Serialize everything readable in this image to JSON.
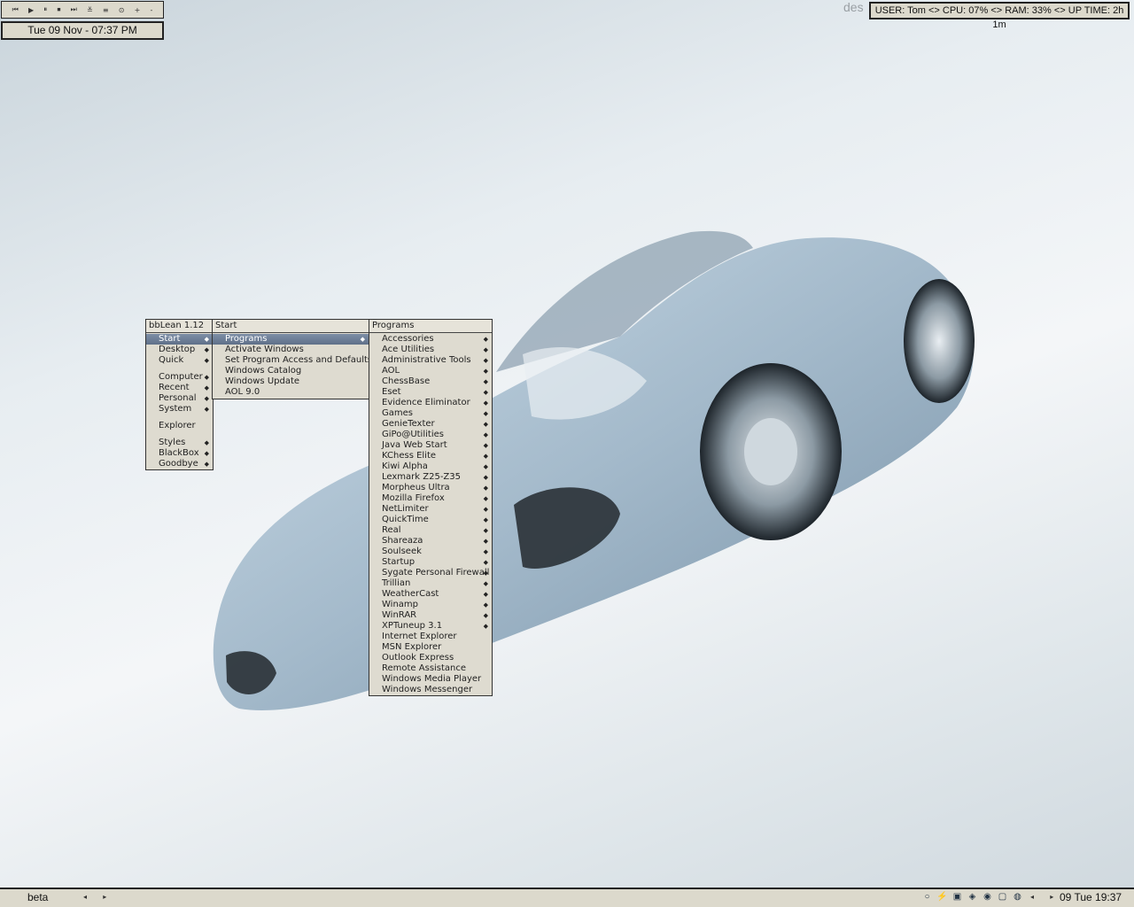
{
  "desktop": {
    "corner_text": "des"
  },
  "media_bar": {
    "buttons": [
      "⏮",
      "▶",
      "⏸",
      "⏹",
      "⏭",
      "≚",
      "≡",
      "⊙",
      "+",
      "-"
    ]
  },
  "clock": {
    "text": "Tue 09 Nov - 07:37 PM"
  },
  "sysmon": {
    "text": "USER: Tom <> CPU: 07% <> RAM: 33% <> UP TIME: 2h 1m"
  },
  "menus": {
    "root": {
      "title": "bbLean 1.12",
      "items": [
        {
          "label": "Start",
          "submenu": true
        },
        {
          "label": "Desktop",
          "submenu": true
        },
        {
          "label": "Quick",
          "submenu": true
        },
        {
          "label": "Computer",
          "submenu": true
        },
        {
          "label": "Recent",
          "submenu": true
        },
        {
          "label": "Personal",
          "submenu": true
        },
        {
          "label": "System",
          "submenu": true
        },
        {
          "label": "Explorer",
          "submenu": false
        },
        {
          "label": "Styles",
          "submenu": true
        },
        {
          "label": "BlackBox",
          "submenu": true
        },
        {
          "label": "Goodbye",
          "submenu": true
        }
      ]
    },
    "start": {
      "title": "Start",
      "items": [
        {
          "label": "Programs",
          "submenu": true
        },
        {
          "label": "Activate Windows",
          "submenu": false
        },
        {
          "label": "Set Program Access and Defaults",
          "submenu": false
        },
        {
          "label": "Windows Catalog",
          "submenu": false
        },
        {
          "label": "Windows Update",
          "submenu": false
        },
        {
          "label": "AOL 9.0",
          "submenu": false
        }
      ]
    },
    "programs": {
      "title": "Programs",
      "items": [
        {
          "label": "Accessories",
          "submenu": true
        },
        {
          "label": "Ace Utilities",
          "submenu": true
        },
        {
          "label": "Administrative Tools",
          "submenu": true
        },
        {
          "label": "AOL",
          "submenu": true
        },
        {
          "label": "ChessBase",
          "submenu": true
        },
        {
          "label": "Eset",
          "submenu": true
        },
        {
          "label": "Evidence Eliminator",
          "submenu": true
        },
        {
          "label": "Games",
          "submenu": true
        },
        {
          "label": "GenieTexter",
          "submenu": true
        },
        {
          "label": "GiPo@Utilities",
          "submenu": true
        },
        {
          "label": "Java Web Start",
          "submenu": true
        },
        {
          "label": "KChess Elite",
          "submenu": true
        },
        {
          "label": "Kiwi Alpha",
          "submenu": true
        },
        {
          "label": "Lexmark Z25-Z35",
          "submenu": true
        },
        {
          "label": "Morpheus Ultra",
          "submenu": true
        },
        {
          "label": "Mozilla Firefox",
          "submenu": true
        },
        {
          "label": "NetLimiter",
          "submenu": true
        },
        {
          "label": "QuickTime",
          "submenu": true
        },
        {
          "label": "Real",
          "submenu": true
        },
        {
          "label": "Shareaza",
          "submenu": true
        },
        {
          "label": "Soulseek",
          "submenu": true
        },
        {
          "label": "Startup",
          "submenu": true
        },
        {
          "label": "Sygate Personal Firewall",
          "submenu": true
        },
        {
          "label": "Trillian",
          "submenu": true
        },
        {
          "label": "WeatherCast",
          "submenu": true
        },
        {
          "label": "Winamp",
          "submenu": true
        },
        {
          "label": "WinRAR",
          "submenu": true
        },
        {
          "label": "XPTuneup 3.1",
          "submenu": true
        },
        {
          "label": "Internet Explorer",
          "submenu": false
        },
        {
          "label": "MSN Explorer",
          "submenu": false
        },
        {
          "label": "Outlook Express",
          "submenu": false
        },
        {
          "label": "Remote Assistance",
          "submenu": false
        },
        {
          "label": "Windows Media Player",
          "submenu": false
        },
        {
          "label": "Windows Messenger",
          "submenu": false
        }
      ]
    }
  },
  "taskbar": {
    "workspace": "beta",
    "nav_left": "◂ ▸",
    "tray_icons": [
      "o",
      "network-icon",
      "folder-icon",
      "app-icon",
      "disk-icon",
      "window-icon",
      "globe-icon"
    ],
    "nav_right": "◂ ▸",
    "clock": "09 Tue 19:37"
  },
  "colors": {
    "menu_bg": "#dedbd0",
    "selected": "#6a7b94",
    "border": "#222222"
  }
}
